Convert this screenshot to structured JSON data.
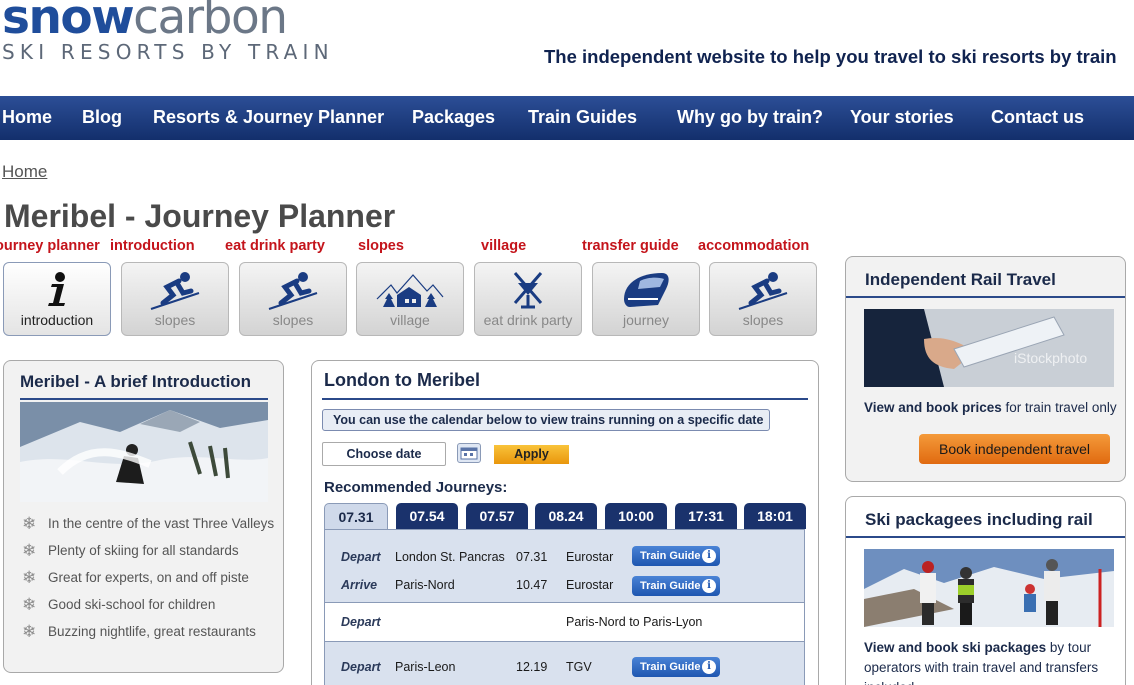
{
  "brand": {
    "logo_snow": "snow",
    "logo_carbon": "carbon",
    "logo_sub": "SKI RESORTS BY TRAIN",
    "tagline": "The independent website to help you travel to ski resorts by train"
  },
  "nav": [
    "Home",
    "Blog",
    "Resorts & Journey Planner",
    "Packages",
    "Train Guides",
    "Why go by train?",
    "Your stories",
    "Contact us"
  ],
  "breadcrumb": "Home",
  "page_title": "Meribel - Journey Planner",
  "section_labels": [
    "journey planner",
    "introduction",
    "eat drink party",
    "slopes",
    "village",
    "transfer guide",
    "accommodation"
  ],
  "tiles": [
    {
      "label": "introduction",
      "icon": "info-icon"
    },
    {
      "label": "slopes",
      "icon": "skier-icon"
    },
    {
      "label": "slopes",
      "icon": "skier-icon"
    },
    {
      "label": "village",
      "icon": "village-icon"
    },
    {
      "label": "eat drink party",
      "icon": "cutlery-glass-icon"
    },
    {
      "label": "journey",
      "icon": "train-icon"
    },
    {
      "label": "slopes",
      "icon": "skier-icon"
    }
  ],
  "intro": {
    "title": "Meribel - A brief Introduction",
    "points": [
      "In the centre of the vast Three Valleys",
      "Plenty of skiing for all standards",
      "Great for experts, on and off piste",
      "Good ski-school for children",
      "Buzzing nightlife, great restaurants"
    ]
  },
  "journey": {
    "title": "London to Meribel",
    "notice": "You can use the calendar below to view trains running on a specific date",
    "date_button": "Choose date",
    "apply": "Apply",
    "recommended": "Recommended Journeys:",
    "times": [
      "07.31",
      "07.54",
      "07.57",
      "08.24",
      "10:00",
      "17:31",
      "18:01"
    ],
    "leg1": {
      "depart_label": "Depart",
      "depart_station": "London St. Pancras",
      "depart_time": "07.31",
      "depart_operator": "Eurostar",
      "arrive_label": "Arrive",
      "arrive_station": "Paris-Nord",
      "arrive_time": "10.47",
      "arrive_operator": "Eurostar",
      "guide": "Train Guide"
    },
    "transfer": {
      "label": "Depart",
      "text": "Paris-Nord to Paris-Lyon"
    },
    "leg2": {
      "depart_label": "Depart",
      "station": "Paris-Leon",
      "time": "12.19",
      "operator": "TGV",
      "guide": "Train Guide"
    }
  },
  "rail": {
    "title": "Independent Rail Travel",
    "image_watermark": "iStockphoto",
    "desc_bold": "View and book prices",
    "desc_rest": " for train travel only",
    "button": "Book independent travel"
  },
  "packages": {
    "title": "Ski packagees including rail",
    "desc_bold": "View and book ski packages",
    "desc_rest": " by tour operators with train travel and transfers included"
  },
  "colors": {
    "nav": "#1f3e82",
    "red_label": "#c4141b",
    "orange": "#e9960c"
  }
}
